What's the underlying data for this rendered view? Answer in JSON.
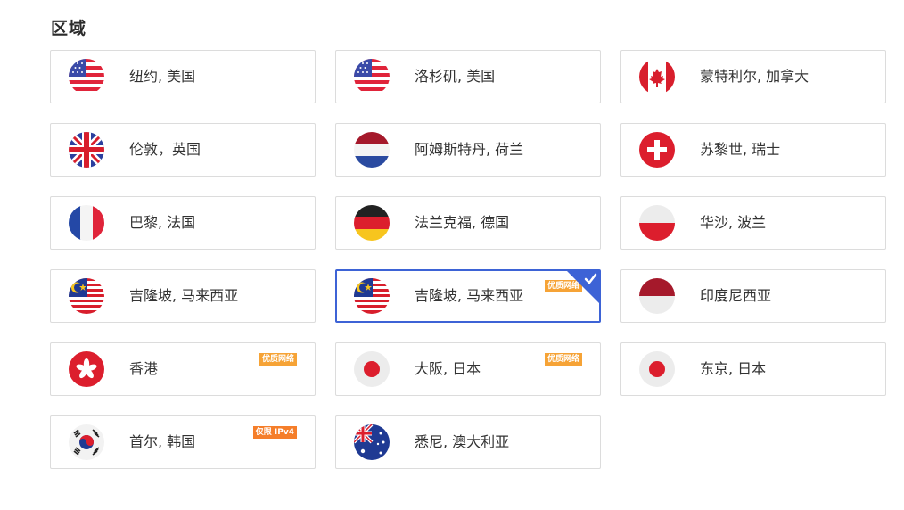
{
  "section_title": "区域",
  "regions": [
    {
      "name": "纽约, 美国",
      "flag": "us-flag-icon",
      "badge": ""
    },
    {
      "name": "洛杉矶, 美国",
      "flag": "us-flag-icon",
      "badge": ""
    },
    {
      "name": "蒙特利尔, 加拿大",
      "flag": "canada-flag-icon",
      "badge": ""
    },
    {
      "name": "伦敦，英国",
      "flag": "uk-flag-icon",
      "badge": ""
    },
    {
      "name": "阿姆斯特丹, 荷兰",
      "flag": "netherlands-flag-icon",
      "badge": ""
    },
    {
      "name": "苏黎世, 瑞士",
      "flag": "switzerland-flag-icon",
      "badge": ""
    },
    {
      "name": "巴黎, 法国",
      "flag": "france-flag-icon",
      "badge": ""
    },
    {
      "name": "法兰克福, 德国",
      "flag": "germany-flag-icon",
      "badge": ""
    },
    {
      "name": "华沙, 波兰",
      "flag": "poland-flag-icon",
      "badge": ""
    },
    {
      "name": "吉隆坡, 马来西亚",
      "flag": "malaysia-flag-icon",
      "badge": ""
    },
    {
      "name": "吉隆坡, 马来西亚",
      "flag": "malaysia-flag-icon",
      "badge": "优质网络",
      "selected": true
    },
    {
      "name": "印度尼西亚",
      "flag": "indonesia-flag-icon",
      "badge": ""
    },
    {
      "name": "香港",
      "flag": "hongkong-flag-icon",
      "badge": "优质网络"
    },
    {
      "name": "大阪, 日本",
      "flag": "japan-flag-icon",
      "badge": "优质网络"
    },
    {
      "name": "东京, 日本",
      "flag": "japan-flag-icon",
      "badge": ""
    },
    {
      "name": "首尔, 韩国",
      "flag": "korea-flag-icon",
      "badge": "仅限 IPv4"
    },
    {
      "name": "悉尼, 澳大利亚",
      "flag": "australia-flag-icon",
      "badge": ""
    }
  ],
  "colors": {
    "selected_border": "#3d63d6",
    "badge_premium": "#f6a336",
    "badge_ipv4": "#f57e2a",
    "card_border": "#dcdcdc"
  }
}
